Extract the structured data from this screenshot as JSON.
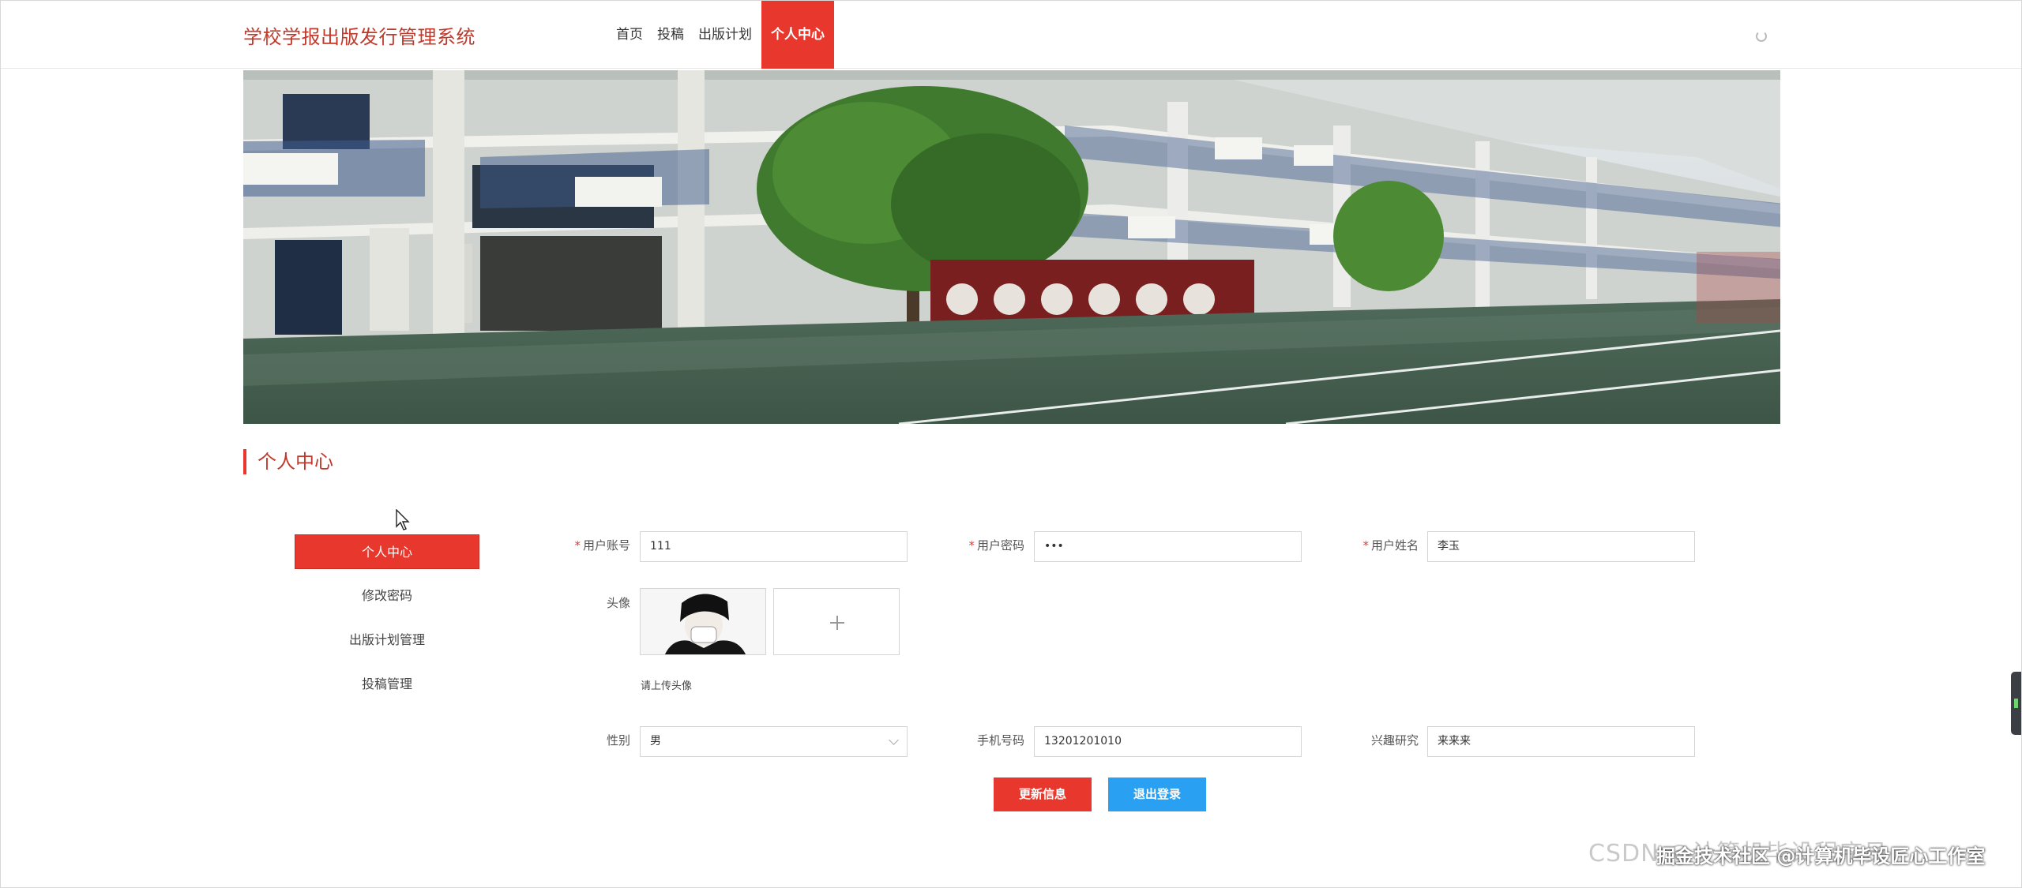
{
  "header": {
    "site_title": "学校学报出版发行管理系统",
    "nav": [
      "首页",
      "投稿",
      "出版计划",
      "个人中心"
    ],
    "active_nav": "个人中心"
  },
  "section": {
    "title": "个人中心"
  },
  "side_menu": {
    "items": [
      "个人中心",
      "修改密码",
      "出版计划管理",
      "投稿管理"
    ],
    "active": "个人中心"
  },
  "form": {
    "username": {
      "label": "用户账号",
      "value": "111",
      "required": true
    },
    "password": {
      "label": "用户密码",
      "value": "•••",
      "required": true
    },
    "realname": {
      "label": "用户姓名",
      "value": "李玉",
      "required": true
    },
    "avatar": {
      "label": "头像",
      "hint": "请上传头像"
    },
    "gender": {
      "label": "性别",
      "value": "男"
    },
    "phone": {
      "label": "手机号码",
      "value": "13201201010"
    },
    "interest": {
      "label": "兴趣研究",
      "value": "来来来"
    }
  },
  "buttons": {
    "update": "更新信息",
    "logout": "退出登录"
  },
  "watermark": {
    "back": "CSDN @计算机毕设程序员",
    "front": "掘金技术社区 @计算机毕设匠心工作室"
  },
  "colors": {
    "accent": "#e8382d",
    "title": "#c0392b",
    "logout": "#2aa0f2"
  }
}
